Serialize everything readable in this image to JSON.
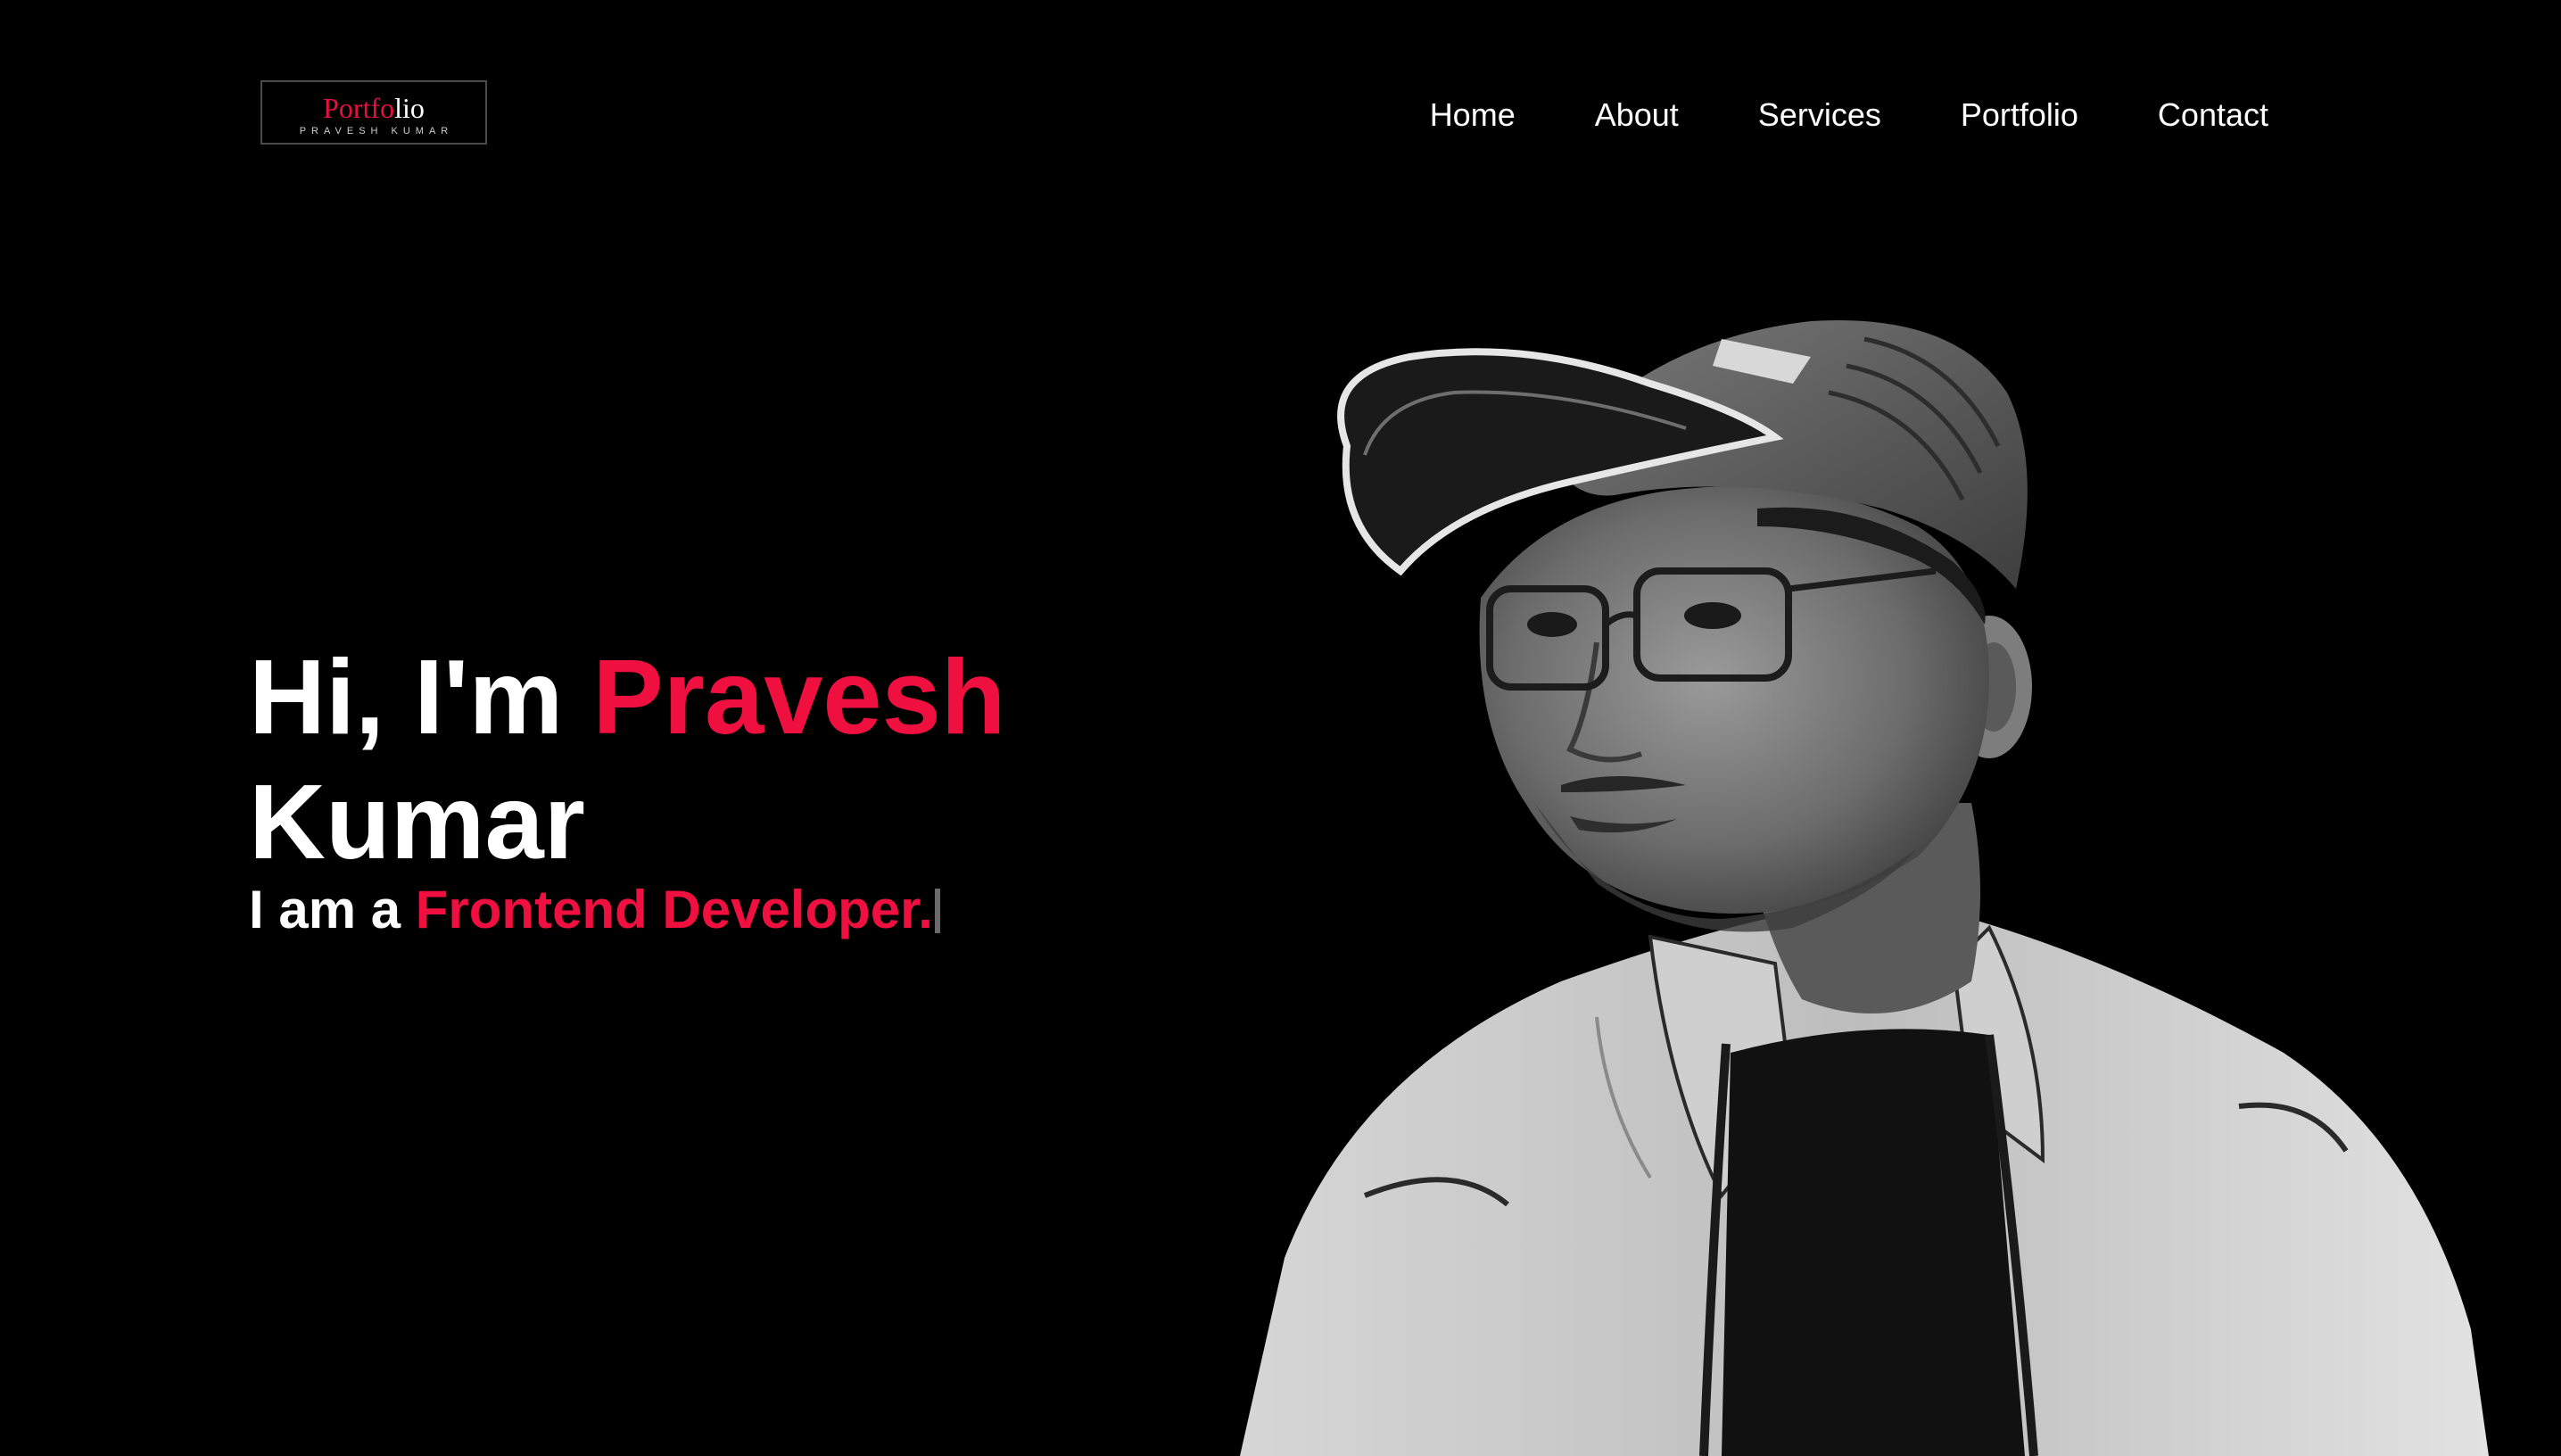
{
  "logo": {
    "word_accent": "Portfo",
    "word_plain": "lio",
    "subtitle": "PRAVESH KUMAR"
  },
  "nav": {
    "items": [
      "Home",
      "About",
      "Services",
      "Portfolio",
      "Contact"
    ]
  },
  "hero": {
    "greeting": "Hi, I'm ",
    "first_name": "Pravesh",
    "last_name": "Kumar",
    "role_prefix": "I am a ",
    "role": "Frontend Developer."
  },
  "colors": {
    "background": "#000000",
    "accent": "#f0103f",
    "text": "#ffffff"
  },
  "portrait": {
    "subject": "grayscale-portrait-man-cap-glasses-jacket"
  }
}
